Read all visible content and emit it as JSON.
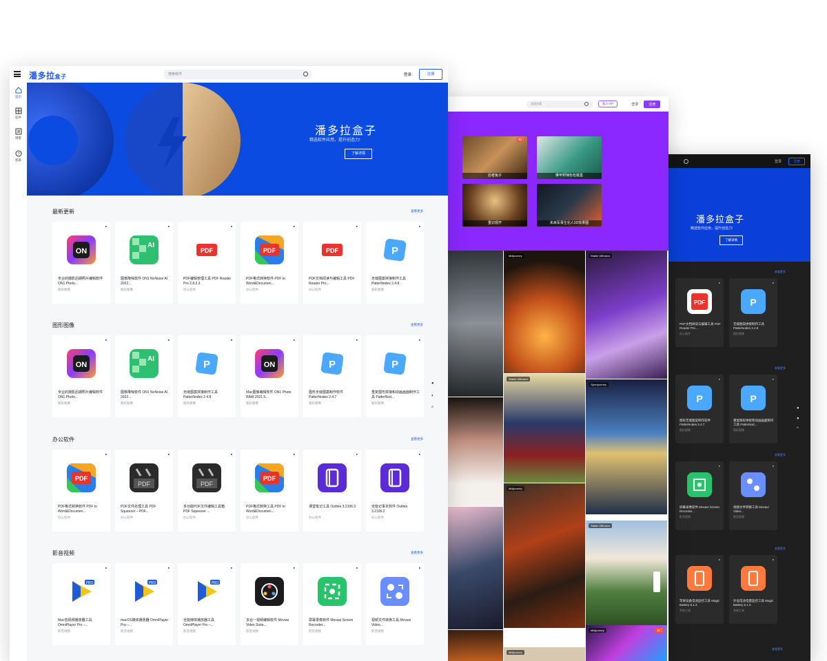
{
  "light": {
    "logo": "潘多拉",
    "logo_small": "盒子",
    "search_placeholder": "搜索软件",
    "login": "登录",
    "register": "注册",
    "rail": [
      {
        "label": "首页"
      },
      {
        "label": "软件"
      },
      {
        "label": "博客"
      },
      {
        "label": "帮助"
      }
    ],
    "hero": {
      "title": "潘多拉盒子",
      "subtitle": "精选软件应用，提升创造力!",
      "button": "了解详情"
    },
    "sections": [
      {
        "title": "最新更新",
        "more": "查看更多",
        "cards": [
          {
            "name": "专业的摄影后期照片编辑软件 ON1 Photo...",
            "cat": "图形图像",
            "icon": "on1-icon"
          },
          {
            "name": "图像降噪软件 ON1 NoNoise AI 2022...",
            "cat": "图形图像",
            "icon": "ai-icon"
          },
          {
            "name": "PDF编辑管理工具 PDF Reader Pro 2.8.2.3",
            "cat": "办公软件",
            "icon": "pdf-red-icon"
          },
          {
            "name": "PDF格式转换软件 PDF to Word&Documen...",
            "cat": "办公软件",
            "icon": "pdf-color-icon"
          },
          {
            "name": "PDF文档阅读与编辑工具 PDF Reader Pro...",
            "cat": "办公软件",
            "icon": "pdf-red-icon"
          },
          {
            "name": "无缝图案拼接制作工具 PatterNodes 2.4.8",
            "cat": "图形图像",
            "icon": "patternodes-icon"
          }
        ]
      },
      {
        "title": "图形图像",
        "more": "查看更多",
        "cards": [
          {
            "name": "专业的摄影后期照片编辑软件 ON1 Photo...",
            "cat": "图形图像",
            "icon": "on1-icon"
          },
          {
            "name": "图像降噪软件 ON1 NoNoise AI 2022...",
            "cat": "图形图像",
            "icon": "ai-icon"
          },
          {
            "name": "无缝图案拼接制作工具 PatterNodes 2.4.8",
            "cat": "图形图像",
            "icon": "patternodes-icon"
          },
          {
            "name": "Mac图像编辑软件 ON1 Photo RAW 2021.5...",
            "cat": "图形图像",
            "icon": "on1-icon"
          },
          {
            "name": "图形无缝图案制作软件 PatterNodes 2.4.7",
            "cat": "图形图像",
            "icon": "patternodes-icon"
          },
          {
            "name": "重复图形拼接和动画画面制作工具 PatterNod...",
            "cat": "图形图像",
            "icon": "patternodes-icon"
          }
        ]
      },
      {
        "title": "办公软件",
        "more": "查看更多",
        "cards": [
          {
            "name": "PDF格式转换软件 PDF to Word&Documen...",
            "cat": "办公软件",
            "icon": "pdf-color-icon"
          },
          {
            "name": "PDF文件处理工具 PDF Squeezer – PDF...",
            "cat": "办公软件",
            "icon": "pdf-squeezer-icon"
          },
          {
            "name": "多功能PDF文件编辑工具箱 PDF Squeezer ...",
            "cat": "办公软件",
            "icon": "pdf-squeezer-icon"
          },
          {
            "name": "PDF格式转换工具 PDF to Word&Documen...",
            "cat": "办公软件",
            "icon": "pdf-color-icon"
          },
          {
            "name": "课堂笔记工具 Outline 3.2106.3",
            "cat": "办公软件",
            "icon": "outline-icon"
          },
          {
            "name": "全能记事本软件 Outline 3.2106.2",
            "cat": "办公软件",
            "icon": "outline-icon"
          }
        ]
      },
      {
        "title": "影音视频",
        "more": "查看更多",
        "cards": [
          {
            "name": "Mac音视频播放器工具 OmniPlayer Pro –...",
            "cat": "影音视频",
            "icon": "omniplayer-icon"
          },
          {
            "name": "macOS媒体播放器 OmniPlayer Pro –...",
            "cat": "影音视频",
            "icon": "omniplayer-icon"
          },
          {
            "name": "全能媒体播放器工具 OmniPlayer Pro –...",
            "cat": "影音视频",
            "icon": "omniplayer-icon"
          },
          {
            "name": "多合一视频编辑软件 Movavi Video Suite...",
            "cat": "影音视频",
            "icon": "movavi-suite-icon"
          },
          {
            "name": "屏幕录像软件 Movavi Screen Recorder...",
            "cat": "影音视频",
            "icon": "screen-recorder-icon"
          },
          {
            "name": "视频文件转换工具 Movavi Video...",
            "cat": "影音视频",
            "icon": "video-convert-icon"
          }
        ]
      }
    ]
  },
  "purple": {
    "search_placeholder": "全部分类",
    "vip": "加入VIP",
    "login": "登录",
    "register": "注册",
    "thumbs": [
      {
        "caption": "后者兔子",
        "hot": "热门"
      },
      {
        "caption": "推甲邦辣色包装盒"
      },
      {
        "caption": "重识观开"
      },
      {
        "caption": "未来军事生化人3D效果图"
      }
    ],
    "gallery_tags": [
      "Midjourney",
      "Stable Diffusion",
      "Stable Diffusion",
      "Openjourney",
      "Midjourney",
      "Stable Diffusion",
      "Midjourney",
      "Midjourney"
    ],
    "gallery_hot": "热门"
  },
  "dark": {
    "login": "登录",
    "register": "注册",
    "hero": {
      "title": "潘多拉盒子",
      "subtitle": "精选软件应用，提升创造力!",
      "button": "了解详情"
    },
    "more": "查看更多",
    "cards": [
      {
        "name": "PDF文档阅读与编辑工具 PDF Reader Pro...",
        "cat": "办公软件",
        "icon": "pdf-red-icon"
      },
      {
        "name": "无缝图案拼接制作工具 PatterNodes 2.4.8",
        "cat": "图形图像",
        "icon": "patternodes-icon"
      },
      {
        "name": "图形无缝图案制作软件 PatterNodes 2.4.7",
        "cat": "图形图像",
        "icon": "patternodes-icon"
      },
      {
        "name": "重复图形拼接和动画画面制作工具 PatterNod...",
        "cat": "图形图像",
        "icon": "patternodes-icon"
      },
      {
        "name": "屏幕录像软件 Movavi Screen Recorder...",
        "cat": "影音视频",
        "icon": "screen-recorder-icon"
      },
      {
        "name": "视频文件转换工具 Movavi Video...",
        "cat": "影音视频",
        "icon": "video-convert-icon"
      },
      {
        "name": "苹果设备电池监控工具 Magic Battery 6.1.3",
        "cat": "系统工具",
        "icon": "magic-battery-icon"
      },
      {
        "name": "外设电池电量监控工具 Magic Battery 6.1.0",
        "cat": "系统工具",
        "icon": "magic-battery-icon"
      }
    ]
  },
  "colors": {
    "brand_blue": "#0b4be0",
    "purple": "#8a28ff",
    "dark_bg": "#1f1f1f"
  }
}
